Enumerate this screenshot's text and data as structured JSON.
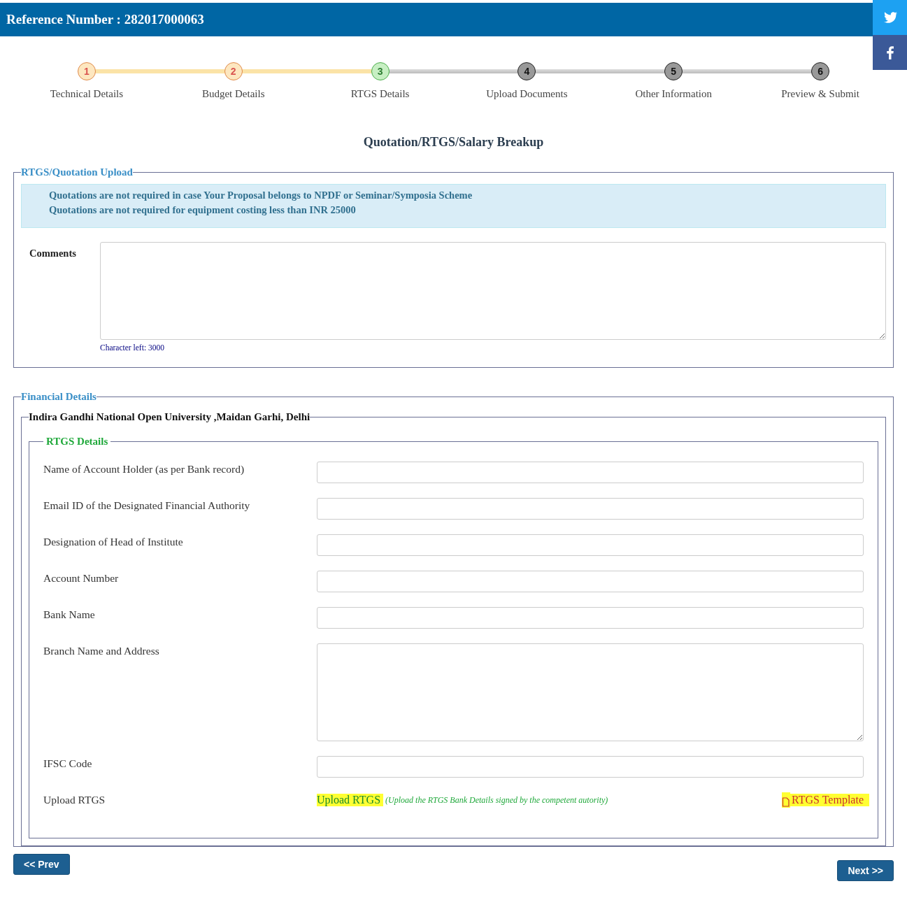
{
  "header": {
    "title": "Reference Number : 282017000063"
  },
  "social": [
    {
      "kind": "bird"
    },
    {
      "kind": "letter"
    }
  ],
  "steps": [
    {
      "number": "1",
      "label": "Technical Details",
      "completed": true,
      "selected": false
    },
    {
      "number": "2",
      "label": "Budget Details",
      "completed": true,
      "selected": false
    },
    {
      "number": "3",
      "label": "RTGS Details",
      "completed": false,
      "selected": true
    },
    {
      "number": "4",
      "label": "Upload Documents",
      "completed": false,
      "selected": false
    },
    {
      "number": "5",
      "label": "Other Information",
      "completed": false,
      "selected": false
    },
    {
      "number": "6",
      "label": "Preview & Submit",
      "completed": false,
      "selected": false
    }
  ],
  "page_title": "Quotation/RTGS/Salary Breakup",
  "quotation_section": {
    "legend": "RTGS/Quotation Upload",
    "notes": [
      "Quotations are not required in case Your Proposal belongs to NPDF or Seminar/Symposia Scheme",
      "Quotations are not required for equipment costing less than INR 25000"
    ],
    "comments_label": "Comments",
    "char_counter": "Character left: 3000"
  },
  "financial_section": {
    "legend": "Financial Details",
    "institute": "Indira Gandhi National Open University ,Maidan Garhi, Delhi",
    "rtgs_legend": "RTGS Details",
    "fields": [
      {
        "kind": "input",
        "label": "Name of Account Holder (as per Bank record)"
      },
      {
        "kind": "input",
        "label": "Email ID of the Designated Financial Authority"
      },
      {
        "kind": "input",
        "label": "Designation of Head of Institute"
      },
      {
        "kind": "input",
        "label": "Account Number"
      },
      {
        "kind": "input",
        "label": "Bank Name"
      },
      {
        "kind": "textarea",
        "label": "Branch Name and Address"
      },
      {
        "kind": "input",
        "label": "IFSC Code"
      },
      {
        "kind": "upload",
        "label": "Upload RTGS",
        "link": "Upload RTGS",
        "hint": "(Upload the RTGS Bank Details signed by the competent autority)",
        "template": "RTGS Template"
      }
    ]
  },
  "buttons": {
    "prev": "<< Prev",
    "next": "Next >>"
  }
}
